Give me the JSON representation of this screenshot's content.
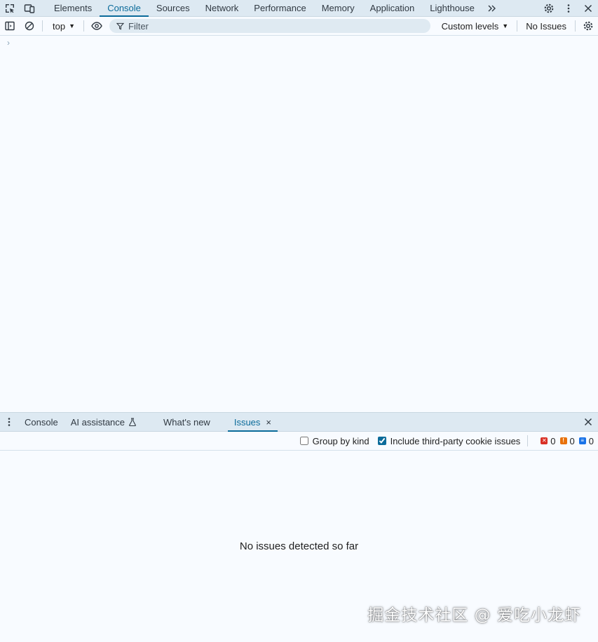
{
  "top_tabs": {
    "tabs": [
      {
        "label": "Elements"
      },
      {
        "label": "Console",
        "active": true
      },
      {
        "label": "Sources"
      },
      {
        "label": "Network"
      },
      {
        "label": "Performance"
      },
      {
        "label": "Memory"
      },
      {
        "label": "Application"
      },
      {
        "label": "Lighthouse"
      }
    ],
    "icons": [
      "inspect-element-icon",
      "device-toolbar-icon",
      "more-tabs-icon",
      "settings-icon",
      "more-options-icon",
      "close-icon"
    ]
  },
  "console_toolbar": {
    "context": "top",
    "filter_placeholder": "Filter",
    "levels": "Custom levels",
    "issues": "No Issues",
    "icons": [
      "sidebar-toggle-icon",
      "clear-console-icon",
      "live-expression-eye-icon",
      "filter-icon",
      "console-settings-icon"
    ]
  },
  "console": {
    "prompt": "›"
  },
  "drawer": {
    "tabs": [
      {
        "label": "Console"
      },
      {
        "label": "AI assistance"
      },
      {
        "label": "What's new"
      },
      {
        "label": "Issues",
        "active": true
      }
    ],
    "close_tab": "×"
  },
  "issues_toolbar": {
    "group_by_kind": {
      "label": "Group by kind",
      "checked": false
    },
    "third_party": {
      "label": "Include third-party cookie issues",
      "checked": true
    },
    "counts": {
      "errors": "0",
      "warnings": "0",
      "info": "0"
    }
  },
  "issues": {
    "empty_message": "No issues detected so far"
  },
  "watermark": "掘金技术社区 @ 爱吃小龙虾",
  "colors": {
    "accent": "#0b6b9a",
    "tab_bar_bg": "#dde9f2",
    "panel_bg": "#f8fbff",
    "error": "#d93025",
    "warning": "#e8710a",
    "info": "#1a73e8"
  }
}
